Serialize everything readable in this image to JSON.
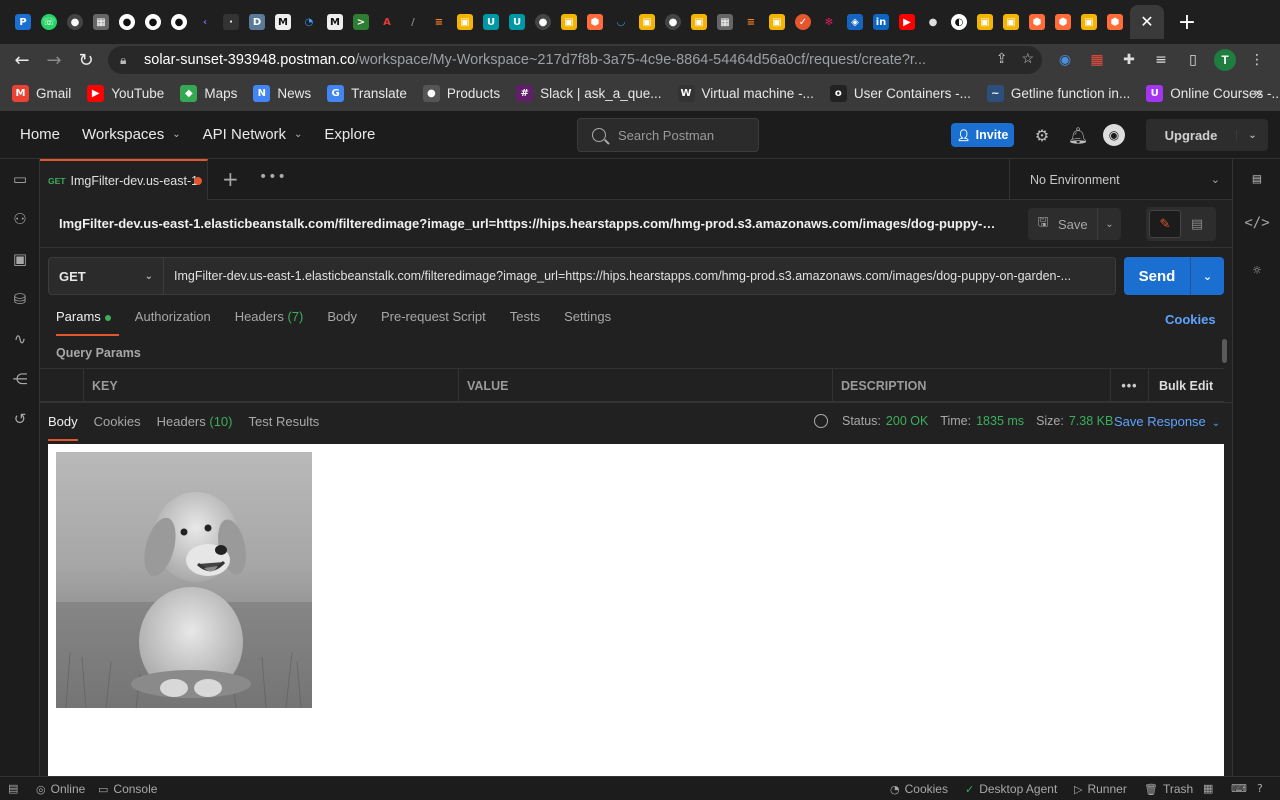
{
  "browser": {
    "active_tab_close": "✕",
    "new_tab": "+",
    "address": {
      "host": "solar-sunset-393948.postman.co",
      "path": "/workspace/My-Workspace~217d7f8b-3a75-4c9e-8864-54464d56a0cf/request/create?r..."
    },
    "profile_initial": "T"
  },
  "bookmarks": [
    {
      "label": "Gmail",
      "icon": "M",
      "color": "#ea4335"
    },
    {
      "label": "YouTube",
      "icon": "▶",
      "color": "#ff0000"
    },
    {
      "label": "Maps",
      "icon": "◆",
      "color": "#34a853"
    },
    {
      "label": "News",
      "icon": "N",
      "color": "#4285f4"
    },
    {
      "label": "Translate",
      "icon": "G",
      "color": "#4285f4"
    },
    {
      "label": "Products",
      "icon": "●",
      "color": "#555555"
    },
    {
      "label": "Slack | ask_a_que...",
      "icon": "#",
      "color": "#611f69"
    },
    {
      "label": "Virtual machine -...",
      "icon": "W",
      "color": "#333333"
    },
    {
      "label": "User Containers -...",
      "icon": "o",
      "color": "#222222"
    },
    {
      "label": "Getline function in...",
      "icon": "~",
      "color": "#2c4f7c"
    },
    {
      "label": "Online Courses -...",
      "icon": "U",
      "color": "#a435f0"
    }
  ],
  "postman": {
    "nav": [
      {
        "label": "Home"
      },
      {
        "label": "Workspaces",
        "chevron": true
      },
      {
        "label": "API Network",
        "chevron": true
      },
      {
        "label": "Explore"
      }
    ],
    "search_placeholder": "Search Postman",
    "invite_label": "Invite",
    "upgrade_label": "Upgrade",
    "request_tab": {
      "method": "GET",
      "name": "ImgFilter-dev.us-east-1"
    },
    "environment": "No Environment",
    "request_title": "ImgFilter-dev.us-east-1.elasticbeanstalk.com/filteredimage?image_url=https://hips.hearstapps.com/hmg-prod.s3.amazonaws.com/images/dog-puppy-on-gar...",
    "save_label": "Save",
    "method": "GET",
    "url": "ImgFilter-dev.us-east-1.elasticbeanstalk.com/filteredimage?image_url=https://hips.hearstapps.com/hmg-prod.s3.amazonaws.com/images/dog-puppy-on-garden-...",
    "send_label": "Send",
    "request_tabs": {
      "params": "Params",
      "authorization": "Authorization",
      "headers": "Headers",
      "headers_count": "(7)",
      "body": "Body",
      "prerequest": "Pre-request Script",
      "tests": "Tests",
      "settings": "Settings"
    },
    "cookies_link": "Cookies",
    "query_params_label": "Query Params",
    "table_headers": {
      "key": "KEY",
      "value": "VALUE",
      "description": "DESCRIPTION",
      "bulk_edit": "Bulk Edit",
      "more": "•••"
    },
    "response_tabs": {
      "body": "Body",
      "cookies": "Cookies",
      "headers": "Headers",
      "headers_count": "(10)",
      "test_results": "Test Results"
    },
    "response_meta": {
      "status_label": "Status:",
      "status_value": "200 OK",
      "time_label": "Time:",
      "time_value": "1835 ms",
      "size_label": "Size:",
      "size_value": "7.38 KB"
    },
    "save_response_label": "Save Response",
    "statusbar": {
      "online": "Online",
      "console": "Console",
      "cookies": "Cookies",
      "desktop_agent": "Desktop Agent",
      "runner": "Runner",
      "trash": "Trash"
    }
  },
  "colors": {
    "accent": "#e4572e",
    "primary_button": "#1a6fd1",
    "success": "#3cae5c",
    "link": "#5fa3ff"
  }
}
